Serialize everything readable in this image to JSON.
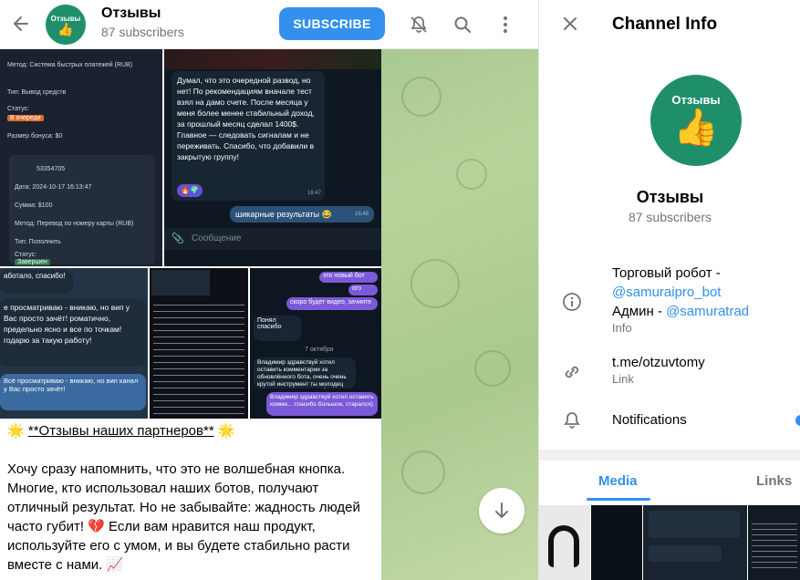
{
  "header": {
    "title": "Отзывы",
    "subtitle": "87 subscribers",
    "subscribe_label": "SUBSCRIBE",
    "avatar_text": "Отзывы"
  },
  "post": {
    "shot1": {
      "method_label": "Метод: Система быстрых платежей (RUB)",
      "type_label": "Тип: Вывод средств",
      "status_label": "Статус:",
      "status_badge": "В очереди",
      "bonus_label": "Размер бонуса: $0",
      "id": "53354705",
      "date": "Дата: 2024-10-17 16:13:47",
      "sum": "Сумма: $100",
      "method2": "Метод: Перевод по номеру карты (RUB)",
      "type2": "Тип: Пополнить",
      "status2": "Статус:",
      "status2_badge": "Завершен"
    },
    "shot2": {
      "text": "Думал, что это очередной развод, но нет! По рекомендациям вначале тест взял на дамо счете. После месяца у меня более менее стабильный доход, за прошлый месяц сделал 1400$. Главное — следовать сигналам и не переживать. Спасибо, что добавили в закрытую группу!",
      "time": "16:47",
      "reply": "шикарные результаты 😂",
      "reply_time": "16:48",
      "input_placeholder": "Сообщение"
    },
    "shot3": {
      "line1": "аботало, спасибо!",
      "line2": "е просматриваю - вникаю, но вип у Вас просто зачёт! роматично, предельно ясно и все по точкам! годарю за такую работу!",
      "line3": "Всё просматриваю - вникаю, но вип канал у Вас просто зачёт!"
    },
    "shot5": {
      "b1": "это новый бот",
      "b2": "ого",
      "b3": "скоро будет видео, зачиите",
      "b4": "Понял спасибо",
      "date": "7 октября",
      "b5": "Владимир здравствуй хотел оставить комментарии за обновлённого бота, очень очень крутой инструмент ты молодец красавчик так держать 💪",
      "b6": "Владимир здравствуй хотел оставить комме... спасибо большое, старался)"
    },
    "caption_title": "**Отзывы наших партнеров**",
    "caption_star": "🌟",
    "caption_body": "Хочу сразу напомнить, что это не волшебная кнопка. Многие, кто использовал наших ботов, получают отличный результат. Но не забывайте: жадность людей часто губит! 💔 Если вам нравится наш продукт, используйте его с умом, и вы будете стабильно расти вместе с нами. 📈"
  },
  "panel": {
    "title": "Channel Info",
    "name": "Отзывы",
    "subscribers": "87 subscribers",
    "info_line1_prefix": "Торговый робот - ",
    "info_line1_link": "@samuraipro_bot",
    "info_line2_prefix": "Админ - ",
    "info_line2_link": "@samuratrad",
    "info_label": "Info",
    "link_value": "t.me/otzuvtomy",
    "link_label": "Link",
    "notifications_label": "Notifications",
    "tabs": [
      "Media",
      "Links"
    ],
    "active_tab": "Media",
    "accent_color": "#3390ec"
  },
  "icons": {
    "back": "arrow-left-icon",
    "mute": "bell-off-icon",
    "search": "search-icon",
    "more": "more-vertical-icon",
    "close": "close-icon",
    "info": "info-icon",
    "link": "link-icon",
    "notifications": "bell-icon",
    "scroll": "arrow-down-icon"
  }
}
